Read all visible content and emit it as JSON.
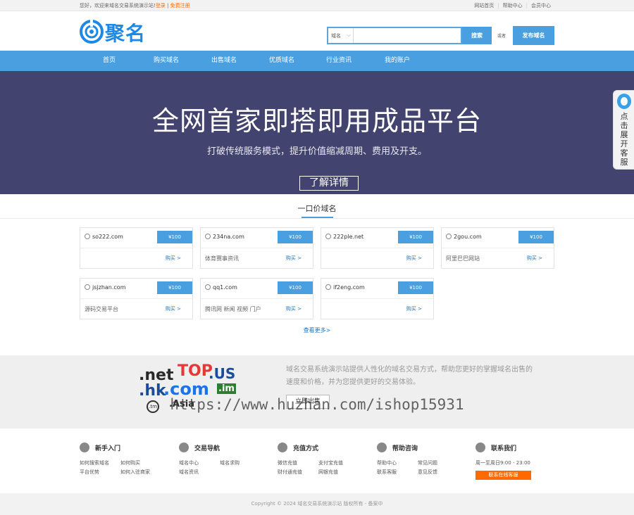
{
  "topbar": {
    "welcome": "您好，欢迎来域名交易系统演示站!",
    "login": "登录",
    "sep": "|",
    "register": "免费注册",
    "links": [
      "网站首页",
      "帮助中心",
      "会员中心"
    ]
  },
  "header": {
    "logo_text": "聚名",
    "search_select": "域名",
    "search_placeholder": "",
    "search_button": "搜索",
    "or_text": "或者",
    "publish_button": "发布域名"
  },
  "nav": {
    "items": [
      "首页",
      "购买域名",
      "出售域名",
      "优质域名",
      "行业资讯",
      "我的账户"
    ]
  },
  "banner": {
    "title": "全网首家即搭即用成品平台",
    "subtitle": "打破传统服务模式，提升价值缩减周期、费用及开支。",
    "button": "了解详情"
  },
  "side_tab": {
    "text": "点击展开客服"
  },
  "section": {
    "title": "一口价域名",
    "more": "查看更多>"
  },
  "domains": [
    {
      "name": "so222.com",
      "price": "¥100",
      "desc": "",
      "buy": "购买 >"
    },
    {
      "name": "234na.com",
      "price": "¥100",
      "desc": "体育赛事资讯",
      "buy": "购买 >"
    },
    {
      "name": "222ple.net",
      "price": "¥100",
      "desc": "",
      "buy": "购买 >"
    },
    {
      "name": "2gou.com",
      "price": "¥100",
      "desc": "阿里巴巴网站",
      "buy": "购买 >"
    },
    {
      "name": "jsjzhan.com",
      "price": "¥100",
      "desc": "源码交易平台",
      "buy": "购买 >"
    },
    {
      "name": "qq1.com",
      "price": "¥100",
      "desc": "腾讯网 新闻 视频 门户",
      "buy": "购买 >"
    },
    {
      "name": "if2eng.com",
      "price": "¥100",
      "desc": "",
      "buy": "购买 >"
    }
  ],
  "promo": {
    "domains_art": {
      "net": ".net",
      "top": "TOP",
      "us": ".US",
      "hk": ".hk",
      "com": ".com",
      "im": ".im",
      "asia": ".Asia",
      "tm": ".tm"
    },
    "text": "域名交易系统演示站提供人性化的域名交易方式，帮助您更好的掌握域名出售的速度和价格，并为您提供更好的交易体验。",
    "button": "立即出售",
    "watermark": "https://www.huzhan.com/ishop15931"
  },
  "footer": {
    "columns": [
      {
        "title": "新手入门",
        "links": [
          "如何搜索域名",
          "如何购买",
          "平台优势",
          "如何入驻商家"
        ]
      },
      {
        "title": "交易导航",
        "links": [
          "域名中心",
          "域名求购",
          "域名资讯"
        ]
      },
      {
        "title": "充值方式",
        "links": [
          "微信充值",
          "支付宝充值",
          "财付通充值",
          "网银充值"
        ]
      },
      {
        "title": "帮助咨询",
        "links": [
          "帮助中心",
          "常见问题",
          "联系客服",
          "意见反馈"
        ]
      }
    ],
    "contact_title": "联系我们",
    "contact_hours": "周一至周日9:00 - 23:00",
    "contact_button": "联系在线客服"
  },
  "copyright": "Copyright © 2024 域名交易系统演示站 版权所有 - 备案中"
}
